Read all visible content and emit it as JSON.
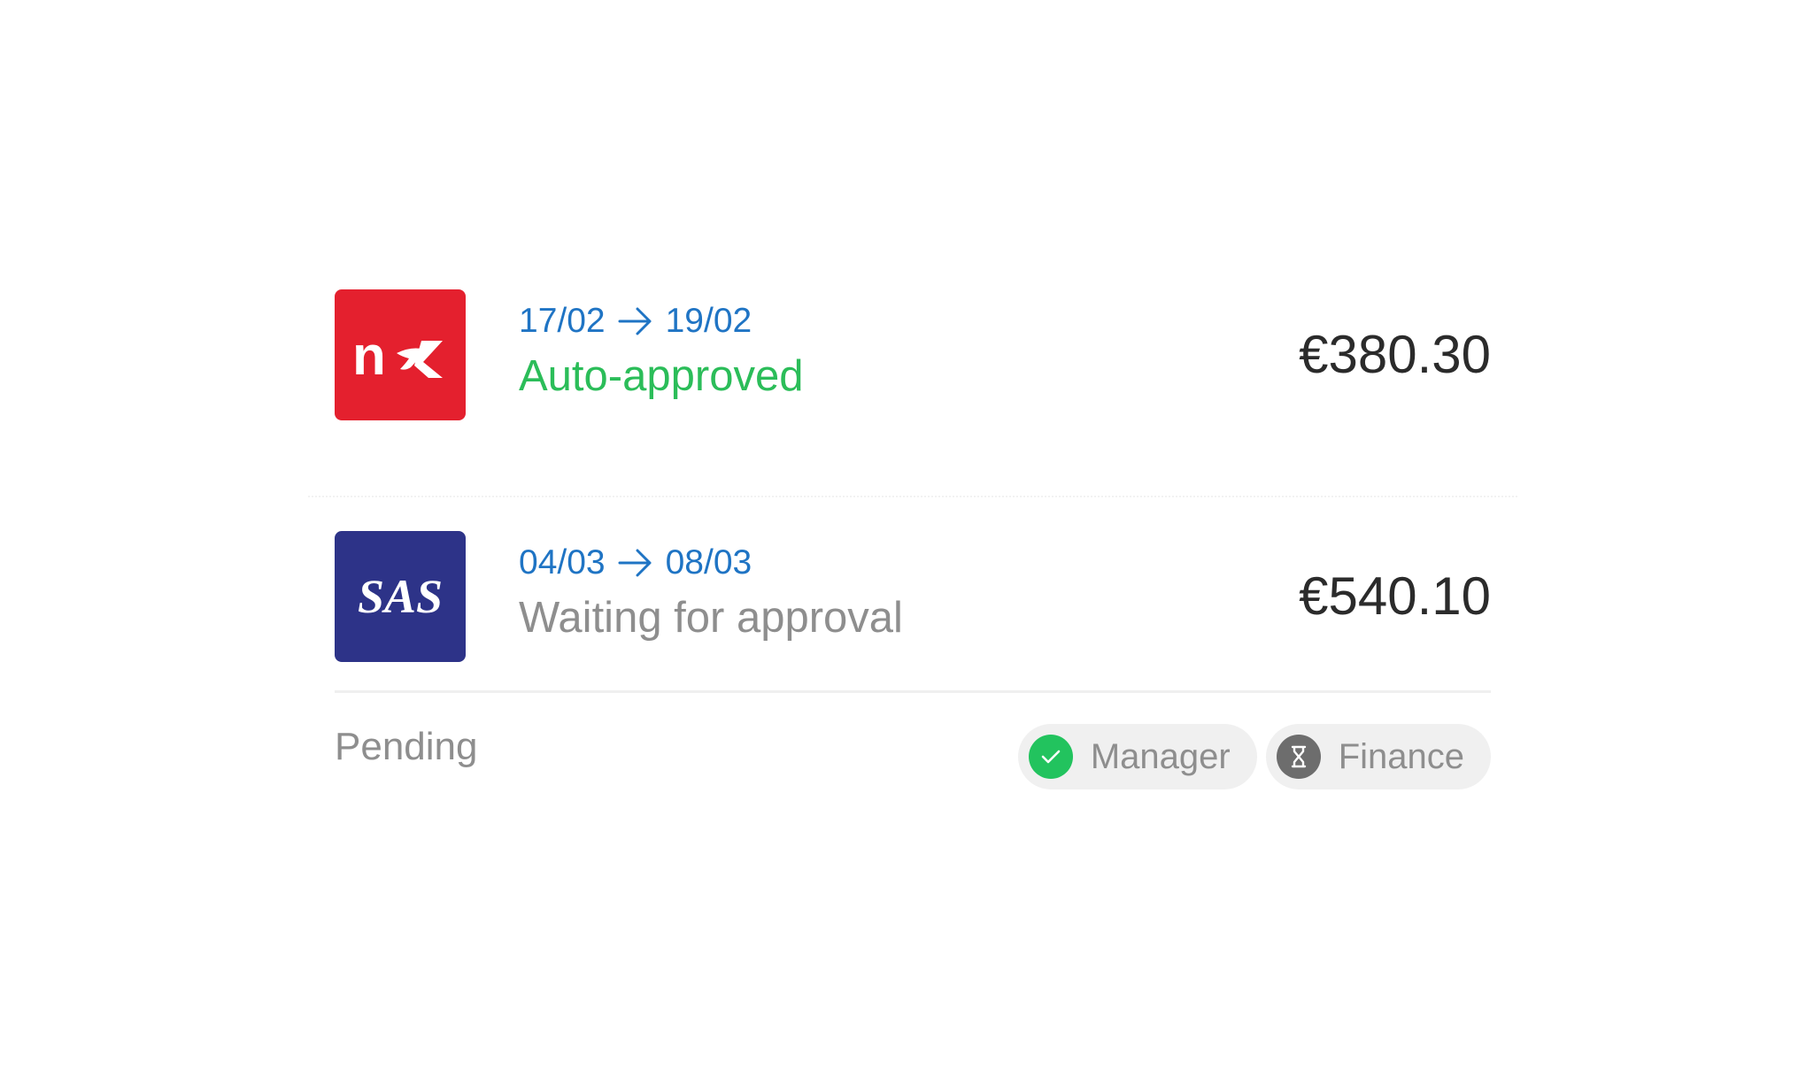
{
  "trips": [
    {
      "airline_logo_text": "nx",
      "airline_color": "#e4202e",
      "start_date": "17/02",
      "end_date": "19/02",
      "status": "Auto-approved",
      "status_color": "#2bbd59",
      "amount": "€380.30"
    },
    {
      "airline_logo_text": "SAS",
      "airline_color": "#2d3388",
      "start_date": "04/03",
      "end_date": "08/03",
      "status": "Waiting for approval",
      "status_color": "#8e8e8e",
      "amount": "€540.10"
    }
  ],
  "approval": {
    "state_label": "Pending",
    "approvers": [
      {
        "label": "Manager",
        "state": "approved",
        "icon": "check-icon",
        "icon_color": "#22c35e"
      },
      {
        "label": "Finance",
        "state": "pending",
        "icon": "hourglass-icon",
        "icon_color": "#6d6d6d"
      }
    ]
  },
  "colors": {
    "date_blue": "#1f74c4",
    "amount_text": "#2b2b2b",
    "muted_text": "#8e8e8e"
  }
}
